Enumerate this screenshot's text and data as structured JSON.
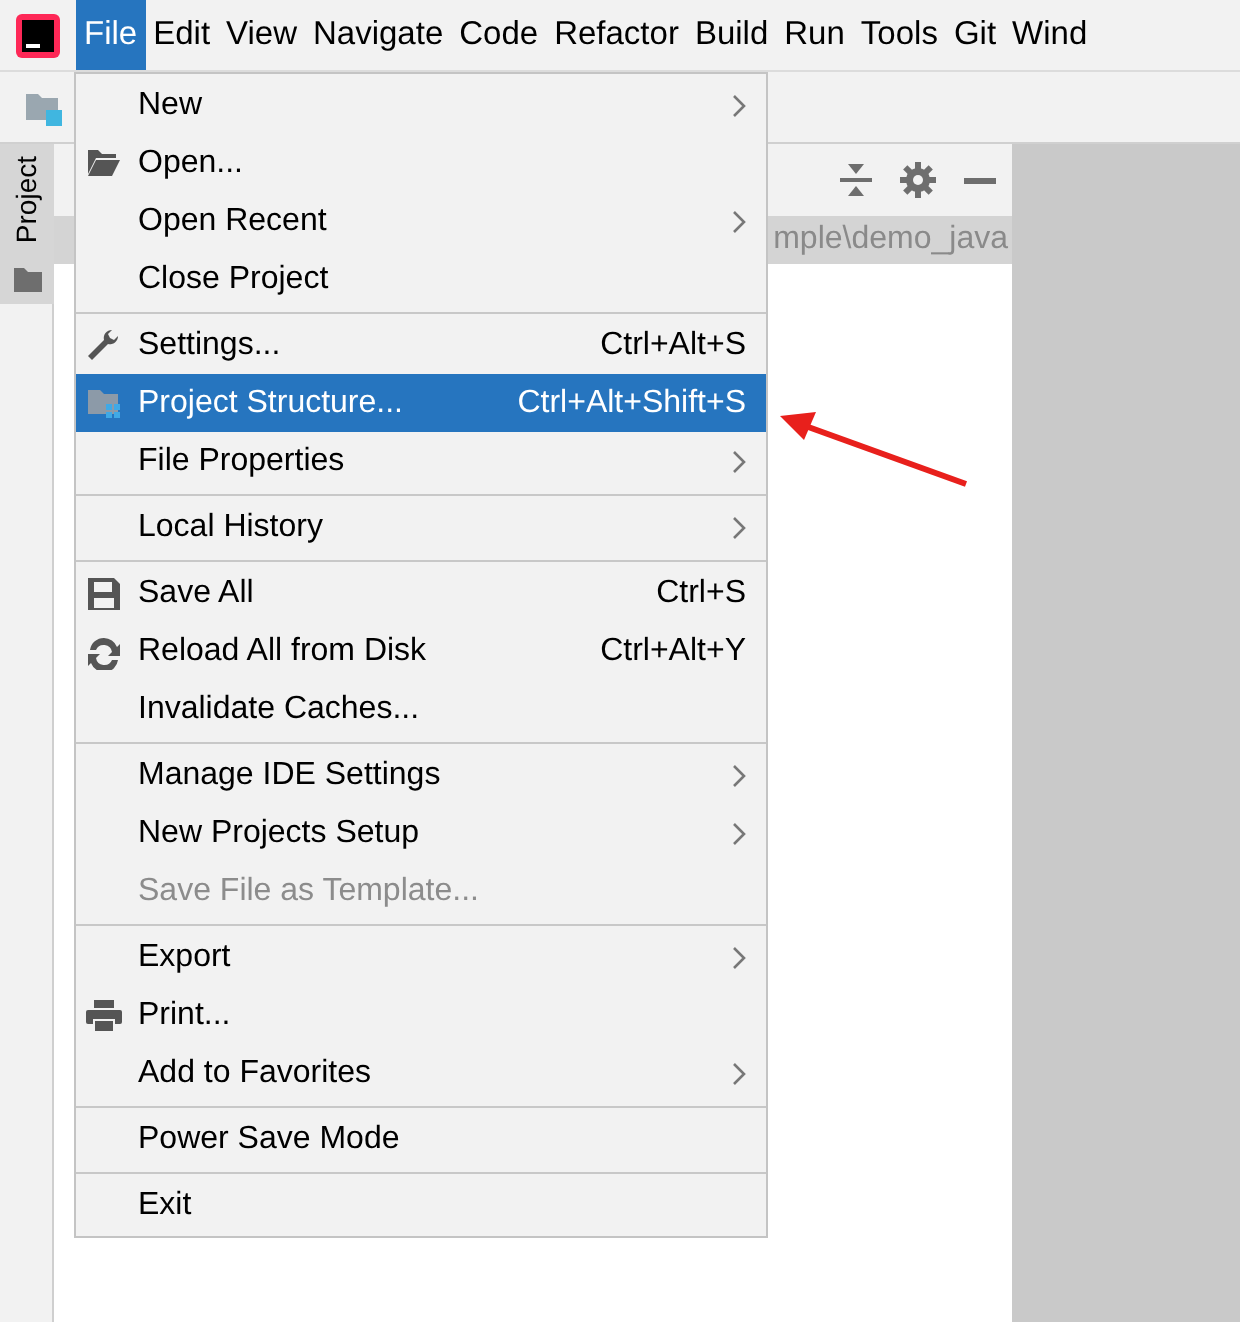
{
  "menu_bar": {
    "items": [
      {
        "label": "File",
        "selected": true
      },
      {
        "label": "Edit",
        "selected": false
      },
      {
        "label": "View",
        "selected": false
      },
      {
        "label": "Navigate",
        "selected": false
      },
      {
        "label": "Code",
        "selected": false
      },
      {
        "label": "Refactor",
        "selected": false
      },
      {
        "label": "Build",
        "selected": false
      },
      {
        "label": "Run",
        "selected": false
      },
      {
        "label": "Tools",
        "selected": false
      },
      {
        "label": "Git",
        "selected": false
      },
      {
        "label": "Wind",
        "selected": false
      }
    ]
  },
  "side_tab": {
    "label": "Project"
  },
  "project_panel": {
    "path": "mple\\demo_java"
  },
  "file_menu": {
    "items": [
      {
        "kind": "item",
        "label": "New",
        "submenu": true
      },
      {
        "kind": "item",
        "label": "Open..."
      },
      {
        "kind": "item",
        "label": "Open Recent",
        "submenu": true
      },
      {
        "kind": "item",
        "label": "Close Project"
      },
      {
        "kind": "separator"
      },
      {
        "kind": "item",
        "label": "Settings...",
        "shortcut": "Ctrl+Alt+S"
      },
      {
        "kind": "item",
        "label": "Project Structure...",
        "shortcut": "Ctrl+Alt+Shift+S",
        "selected": true
      },
      {
        "kind": "item",
        "label": "File Properties",
        "submenu": true
      },
      {
        "kind": "separator"
      },
      {
        "kind": "item",
        "label": "Local History",
        "submenu": true
      },
      {
        "kind": "separator"
      },
      {
        "kind": "item",
        "label": "Save All",
        "shortcut": "Ctrl+S"
      },
      {
        "kind": "item",
        "label": "Reload All from Disk",
        "shortcut": "Ctrl+Alt+Y"
      },
      {
        "kind": "item",
        "label": "Invalidate Caches..."
      },
      {
        "kind": "separator"
      },
      {
        "kind": "item",
        "label": "Manage IDE Settings",
        "submenu": true
      },
      {
        "kind": "item",
        "label": "New Projects Setup",
        "submenu": true
      },
      {
        "kind": "item",
        "label": "Save File as Template...",
        "disabled": true
      },
      {
        "kind": "separator"
      },
      {
        "kind": "item",
        "label": "Export",
        "submenu": true
      },
      {
        "kind": "item",
        "label": "Print..."
      },
      {
        "kind": "item",
        "label": "Add to Favorites",
        "submenu": true
      },
      {
        "kind": "separator"
      },
      {
        "kind": "item",
        "label": "Power Save Mode"
      },
      {
        "kind": "separator"
      },
      {
        "kind": "item",
        "label": "Exit"
      }
    ]
  }
}
